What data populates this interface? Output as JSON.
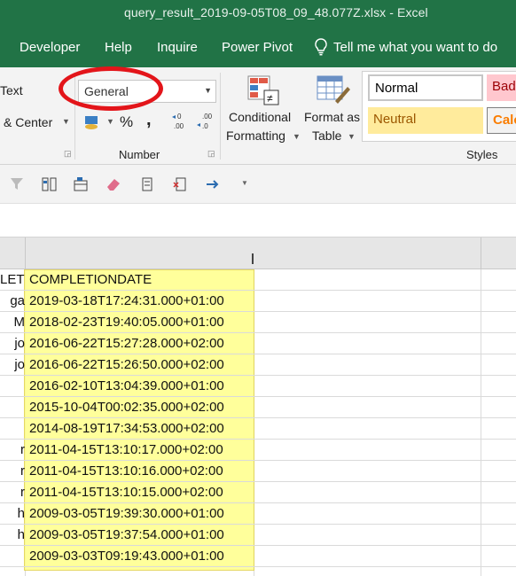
{
  "window": {
    "title": "query_result_2019-09-05T08_09_48.077Z.xlsx  -  Excel"
  },
  "tabs": [
    "Developer",
    "Help",
    "Inquire",
    "Power Pivot"
  ],
  "tell_me": "Tell me what you want to do",
  "ribbon": {
    "wrap_text": "Text",
    "merge_center": "& Center",
    "number_format": "General",
    "percent": "%",
    "comma": ",",
    "number_group": "Number",
    "conditional_formatting": {
      "line1": "Conditional",
      "line2": "Formatting"
    },
    "format_as_table": {
      "line1": "Format as",
      "line2": "Table"
    },
    "styles_group": "Styles",
    "styles": {
      "normal": {
        "label": "Normal",
        "bg": "#ffffff",
        "fg": "#000000"
      },
      "bad": {
        "label": "Bad",
        "bg": "#ffc7ce",
        "fg": "#9c0006"
      },
      "neutral": {
        "label": "Neutral",
        "bg": "#ffeb9c",
        "fg": "#9c5700"
      },
      "calc": {
        "label": "Calc",
        "bg": "#f2f2f2",
        "fg": "#fa7d00"
      }
    }
  },
  "colors": {
    "excel_green": "#217346",
    "highlight": "#ffff8a",
    "annotation_red": "#e3151a"
  },
  "sheet": {
    "header_a": "LETE",
    "header_b": "COMPLETIONDATE",
    "rows": [
      {
        "a": "ga",
        "b": "2019-03-18T17:24:31.000+01:00"
      },
      {
        "a": "M",
        "b": "2018-02-23T19:40:05.000+01:00"
      },
      {
        "a": "jo",
        "b": "2016-06-22T15:27:28.000+02:00"
      },
      {
        "a": "jo",
        "b": "2016-06-22T15:26:50.000+02:00"
      },
      {
        "a": "",
        "b": "2016-02-10T13:04:39.000+01:00"
      },
      {
        "a": "",
        "b": "2015-10-04T00:02:35.000+02:00"
      },
      {
        "a": "",
        "b": "2014-08-19T17:34:53.000+02:00"
      },
      {
        "a": "r",
        "b": "2011-04-15T13:10:17.000+02:00"
      },
      {
        "a": "r",
        "b": "2011-04-15T13:10:16.000+02:00"
      },
      {
        "a": "r",
        "b": "2011-04-15T13:10:15.000+02:00"
      },
      {
        "a": "h",
        "b": "2009-03-05T19:39:30.000+01:00"
      },
      {
        "a": "h",
        "b": "2009-03-05T19:37:54.000+01:00"
      },
      {
        "a": "",
        "b": "2009-03-03T09:19:43.000+01:00"
      }
    ]
  }
}
